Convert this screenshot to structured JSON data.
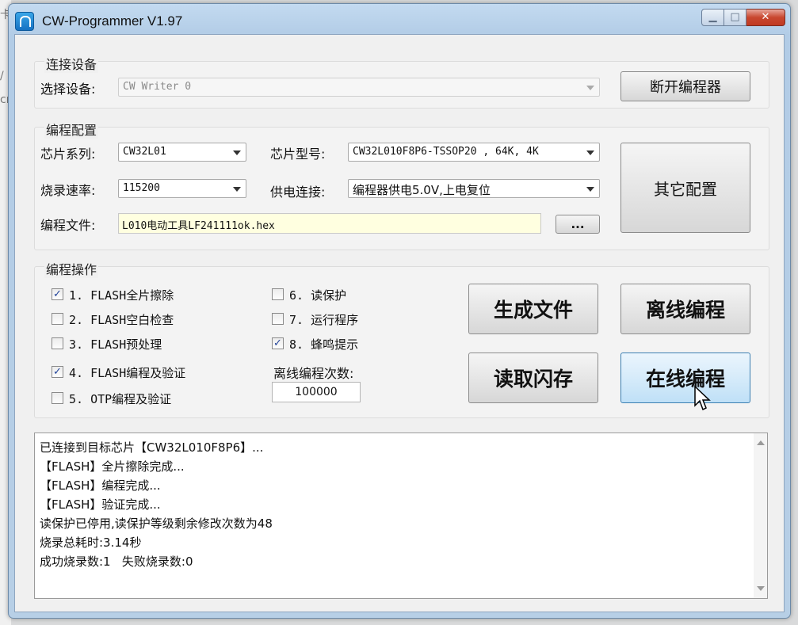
{
  "window": {
    "title": "CW-Programmer V1.97",
    "min_glyph": "▁",
    "max_glyph": "□",
    "close_glyph": "✕"
  },
  "connect": {
    "group_title": "连接设备",
    "select_device_label": "选择设备:",
    "device_value": "CW Writer 0",
    "disconnect_button": "断开编程器"
  },
  "config": {
    "group_title": "编程配置",
    "chip_series_label": "芯片系列:",
    "chip_series_value": "CW32L01",
    "chip_model_label": "芯片型号:",
    "chip_model_value": "CW32L010F8P6-TSSOP20  , 64K, 4K",
    "baud_label": "烧录速率:",
    "baud_value": "115200",
    "power_label": "供电连接:",
    "power_value": "编程器供电5.0V,上电复位",
    "file_label": "编程文件:",
    "file_value": "L010电动工具LF241111ok.hex",
    "browse_button": "...",
    "other_config_button": "其它配置"
  },
  "operations": {
    "group_title": "编程操作",
    "items": [
      {
        "label": "1. FLASH全片擦除",
        "checked": true
      },
      {
        "label": "2. FLASH空白检查",
        "checked": false
      },
      {
        "label": "3. FLASH预处理",
        "checked": false
      },
      {
        "label": "4. FLASH编程及验证",
        "checked": true
      },
      {
        "label": "5. OTP编程及验证",
        "checked": false
      },
      {
        "label": "6. 读保护",
        "checked": false
      },
      {
        "label": "7. 运行程序",
        "checked": false
      },
      {
        "label": "8. 蜂鸣提示",
        "checked": true
      }
    ],
    "offline_count_label": "离线编程次数:",
    "offline_count_value": "100000",
    "generate_file_button": "生成文件",
    "offline_program_button": "离线编程",
    "read_flash_button": "读取闪存",
    "online_program_button": "在线编程"
  },
  "log": {
    "lines": [
      "已连接到目标芯片【CW32L010F8P6】...",
      "【FLASH】全片擦除完成...",
      "【FLASH】编程完成...",
      "【FLASH】验证完成...",
      "读保护已停用,读保护等级剩余修改次数为48",
      "烧录总耗时:3.14秒",
      "成功烧录数:1   失败烧录数:0"
    ]
  }
}
